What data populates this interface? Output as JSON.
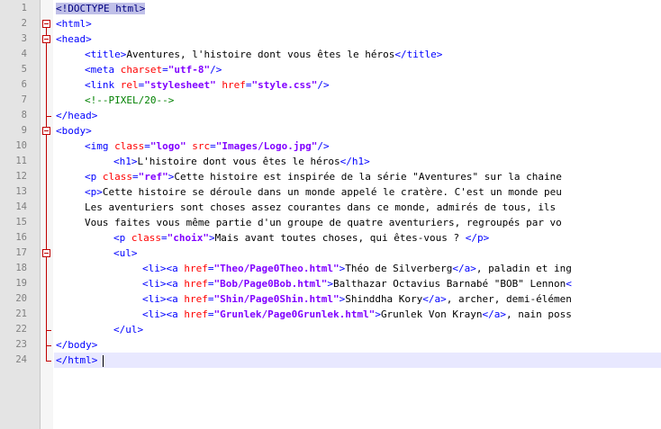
{
  "editor": {
    "current_line": 24,
    "lines": [
      {
        "num": "1",
        "indent": 0,
        "tokens": [
          {
            "t": "<!DOCTYPE html>",
            "c": "doctype-hl"
          }
        ]
      },
      {
        "num": "2",
        "indent": 0,
        "fold": true,
        "tokens": [
          {
            "t": "<html>",
            "c": "tag"
          }
        ]
      },
      {
        "num": "3",
        "indent": 0,
        "fold": true,
        "tokens": [
          {
            "t": "<head>",
            "c": "tag"
          }
        ]
      },
      {
        "num": "4",
        "indent": 1,
        "tokens": [
          {
            "t": "<title>",
            "c": "tag"
          },
          {
            "t": "Aventures, l'histoire dont vous êtes le héros",
            "c": "txt"
          },
          {
            "t": "</title>",
            "c": "tag"
          }
        ]
      },
      {
        "num": "5",
        "indent": 1,
        "tokens": [
          {
            "t": "<meta ",
            "c": "tag"
          },
          {
            "t": "charset",
            "c": "attr"
          },
          {
            "t": "=",
            "c": "tag"
          },
          {
            "t": "\"utf-8\"",
            "c": "val"
          },
          {
            "t": "/>",
            "c": "tag"
          }
        ]
      },
      {
        "num": "6",
        "indent": 1,
        "tokens": [
          {
            "t": "<link ",
            "c": "tag"
          },
          {
            "t": "rel",
            "c": "attr"
          },
          {
            "t": "=",
            "c": "tag"
          },
          {
            "t": "\"stylesheet\"",
            "c": "val"
          },
          {
            "t": " ",
            "c": "txt"
          },
          {
            "t": "href",
            "c": "attr"
          },
          {
            "t": "=",
            "c": "tag"
          },
          {
            "t": "\"style.css\"",
            "c": "val"
          },
          {
            "t": "/>",
            "c": "tag"
          }
        ]
      },
      {
        "num": "7",
        "indent": 1,
        "tokens": [
          {
            "t": "<!--PIXEL/20-->",
            "c": "cmt"
          }
        ]
      },
      {
        "num": "8",
        "indent": 0,
        "tokens": [
          {
            "t": "</head>",
            "c": "tag"
          }
        ]
      },
      {
        "num": "9",
        "indent": 0,
        "fold": true,
        "tokens": [
          {
            "t": "<body>",
            "c": "tag"
          }
        ]
      },
      {
        "num": "10",
        "indent": 1,
        "tokens": [
          {
            "t": "<img ",
            "c": "tag"
          },
          {
            "t": "class",
            "c": "attr"
          },
          {
            "t": "=",
            "c": "tag"
          },
          {
            "t": "\"logo\"",
            "c": "val"
          },
          {
            "t": " ",
            "c": "txt"
          },
          {
            "t": "src",
            "c": "attr"
          },
          {
            "t": "=",
            "c": "tag"
          },
          {
            "t": "\"Images/Logo.jpg\"",
            "c": "val"
          },
          {
            "t": "/>",
            "c": "tag"
          }
        ]
      },
      {
        "num": "11",
        "indent": 2,
        "tokens": [
          {
            "t": "<h1>",
            "c": "tag"
          },
          {
            "t": "L'histoire dont vous êtes le héros",
            "c": "txt"
          },
          {
            "t": "</h1>",
            "c": "tag"
          }
        ]
      },
      {
        "num": "12",
        "indent": 1,
        "tokens": [
          {
            "t": "<p ",
            "c": "tag"
          },
          {
            "t": "class",
            "c": "attr"
          },
          {
            "t": "=",
            "c": "tag"
          },
          {
            "t": "\"ref\"",
            "c": "val"
          },
          {
            "t": ">",
            "c": "tag"
          },
          {
            "t": "Cette histoire est inspirée de la série \"Aventures\" sur la chaine",
            "c": "txt"
          }
        ]
      },
      {
        "num": "13",
        "indent": 1,
        "tokens": [
          {
            "t": "<p>",
            "c": "tag"
          },
          {
            "t": "Cette histoire se déroule dans un monde appelé le cratère. C'est un monde peu",
            "c": "txt"
          }
        ]
      },
      {
        "num": "14",
        "indent": 1,
        "tokens": [
          {
            "t": "Les aventuriers sont choses assez courantes dans ce monde, admirés de tous, ils",
            "c": "txt"
          }
        ]
      },
      {
        "num": "15",
        "indent": 1,
        "tokens": [
          {
            "t": "Vous faites vous même partie d'un groupe de quatre aventuriers, regroupés par vo",
            "c": "txt"
          }
        ]
      },
      {
        "num": "16",
        "indent": 2,
        "tokens": [
          {
            "t": "<p ",
            "c": "tag"
          },
          {
            "t": "class",
            "c": "attr"
          },
          {
            "t": "=",
            "c": "tag"
          },
          {
            "t": "\"choix\"",
            "c": "val"
          },
          {
            "t": ">",
            "c": "tag"
          },
          {
            "t": "Mais avant toutes choses, qui êtes-vous ? ",
            "c": "txt"
          },
          {
            "t": "</p>",
            "c": "tag"
          }
        ]
      },
      {
        "num": "17",
        "indent": 2,
        "fold": true,
        "tokens": [
          {
            "t": "<ul>",
            "c": "tag"
          }
        ]
      },
      {
        "num": "18",
        "indent": 3,
        "tokens": [
          {
            "t": "<li>",
            "c": "tag"
          },
          {
            "t": "<a ",
            "c": "tag"
          },
          {
            "t": "href",
            "c": "attr"
          },
          {
            "t": "=",
            "c": "tag"
          },
          {
            "t": "\"Theo/Page0Theo.html\"",
            "c": "val"
          },
          {
            "t": ">",
            "c": "tag"
          },
          {
            "t": "Théo de Silverberg",
            "c": "txt"
          },
          {
            "t": "</a>",
            "c": "tag"
          },
          {
            "t": ", paladin et ing",
            "c": "txt"
          }
        ]
      },
      {
        "num": "19",
        "indent": 3,
        "tokens": [
          {
            "t": "<li>",
            "c": "tag"
          },
          {
            "t": "<a ",
            "c": "tag"
          },
          {
            "t": "href",
            "c": "attr"
          },
          {
            "t": "=",
            "c": "tag"
          },
          {
            "t": "\"Bob/Page0Bob.html\"",
            "c": "val"
          },
          {
            "t": ">",
            "c": "tag"
          },
          {
            "t": "Balthazar Octavius Barnabé \"BOB\" Lennon",
            "c": "txt"
          },
          {
            "t": "<",
            "c": "tag"
          }
        ]
      },
      {
        "num": "20",
        "indent": 3,
        "tokens": [
          {
            "t": "<li>",
            "c": "tag"
          },
          {
            "t": "<a ",
            "c": "tag"
          },
          {
            "t": "href",
            "c": "attr"
          },
          {
            "t": "=",
            "c": "tag"
          },
          {
            "t": "\"Shin/Page0Shin.html\"",
            "c": "val"
          },
          {
            "t": ">",
            "c": "tag"
          },
          {
            "t": "Shinddha Kory",
            "c": "txt"
          },
          {
            "t": "</a>",
            "c": "tag"
          },
          {
            "t": ", archer, demi-élémen",
            "c": "txt"
          }
        ]
      },
      {
        "num": "21",
        "indent": 3,
        "tokens": [
          {
            "t": "<li>",
            "c": "tag"
          },
          {
            "t": "<a ",
            "c": "tag"
          },
          {
            "t": "href",
            "c": "attr"
          },
          {
            "t": "=",
            "c": "tag"
          },
          {
            "t": "\"Grunlek/Page0Grunlek.html\"",
            "c": "val"
          },
          {
            "t": ">",
            "c": "tag"
          },
          {
            "t": "Grunlek Von Krayn",
            "c": "txt"
          },
          {
            "t": "</a>",
            "c": "tag"
          },
          {
            "t": ", nain poss",
            "c": "txt"
          }
        ]
      },
      {
        "num": "22",
        "indent": 2,
        "tokens": [
          {
            "t": "</ul>",
            "c": "tag"
          }
        ]
      },
      {
        "num": "23",
        "indent": 0,
        "tokens": [
          {
            "t": "</body>",
            "c": "tag"
          }
        ]
      },
      {
        "num": "24",
        "indent": 0,
        "tokens": [
          {
            "t": "</html>",
            "c": "tag"
          }
        ]
      }
    ]
  }
}
